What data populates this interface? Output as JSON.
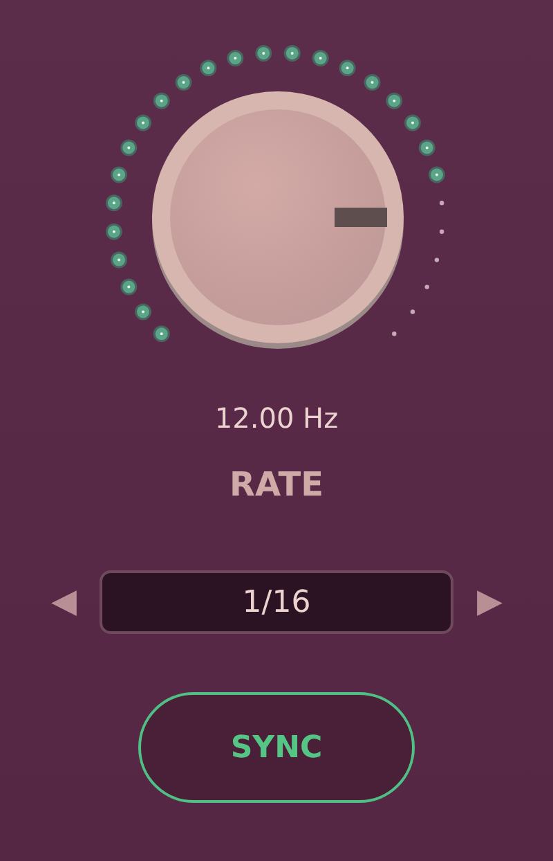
{
  "knob": {
    "readout": "12.00 Hz",
    "label": "RATE"
  },
  "selector": {
    "value": "1/16",
    "prev": "◀",
    "next": "▶"
  },
  "sync": {
    "label": "SYNC",
    "on": true
  }
}
